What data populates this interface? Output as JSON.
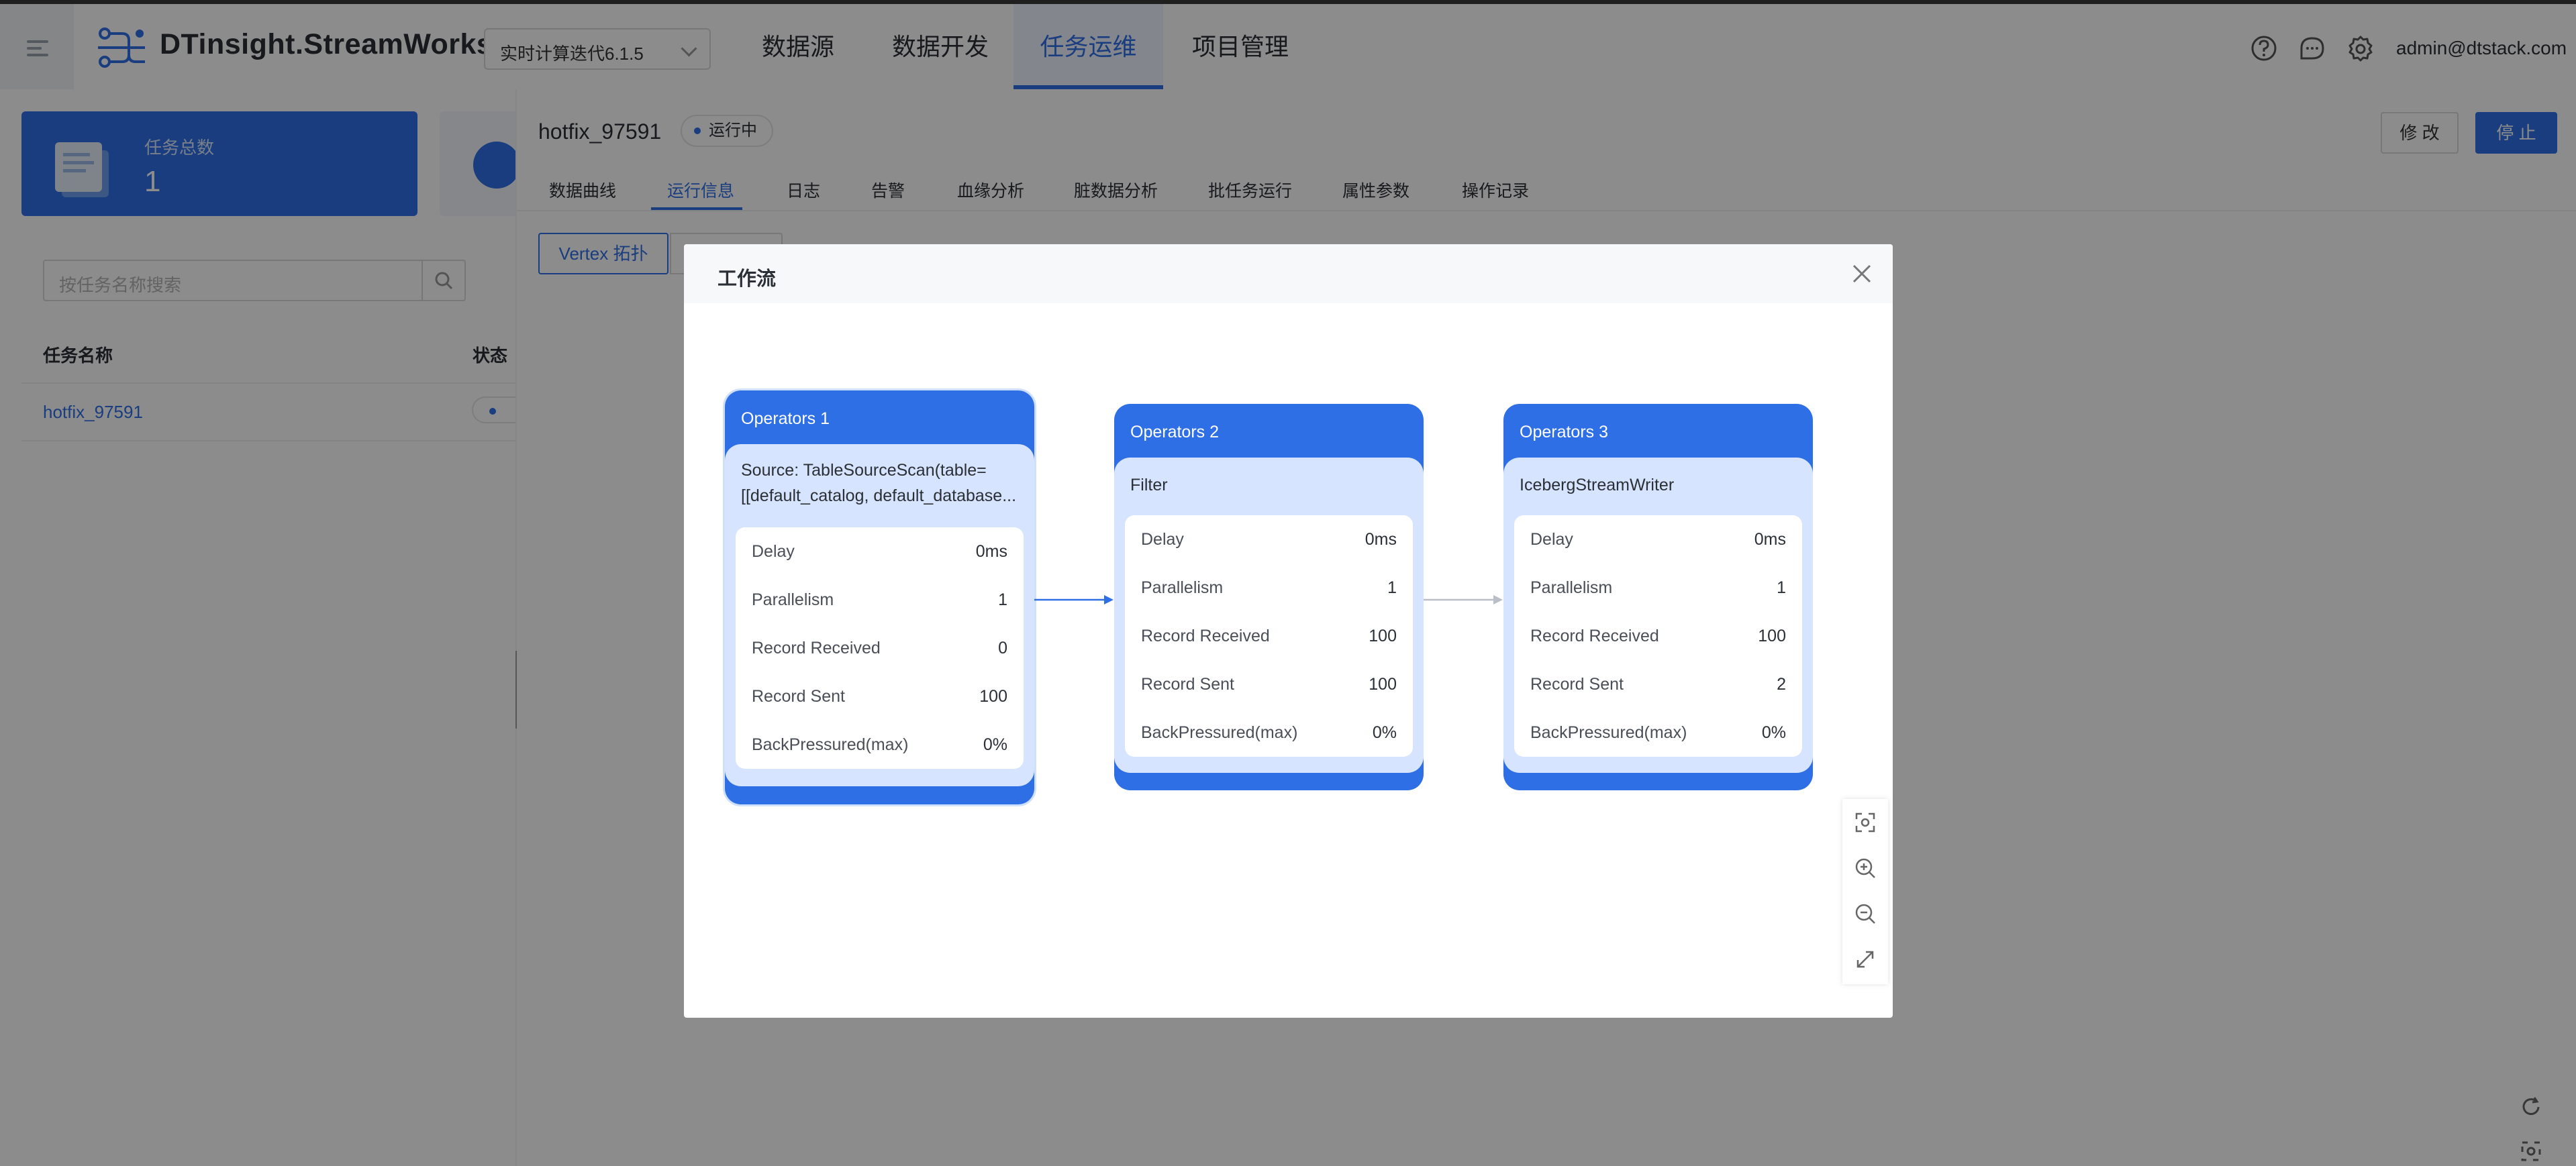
{
  "header": {
    "brand": "DTinsight.StreamWorks",
    "version_select": "实时计算迭代6.1.5",
    "nav": [
      "数据源",
      "数据开发",
      "任务运维",
      "项目管理"
    ],
    "nav_active": "任务运维",
    "user": "admin@dtstack.com",
    "icons": [
      "help-icon",
      "message-icon",
      "settings-icon"
    ]
  },
  "sidebar": {
    "stat_title": "任务总数",
    "stat_value": "1",
    "search_placeholder": "按任务名称搜索",
    "columns": [
      "任务名称",
      "状态"
    ],
    "rows": [
      {
        "name": "hotfix_97591"
      }
    ]
  },
  "task": {
    "name": "hotfix_97591",
    "status": "运行中",
    "edit_label": "修 改",
    "stop_label": "停 止",
    "tabs": [
      "数据曲线",
      "运行信息",
      "日志",
      "告警",
      "血缘分析",
      "脏数据分析",
      "批任务运行",
      "属性参数",
      "操作记录"
    ],
    "tab_active": "运行信息",
    "vertex_button": "Vertex 拓扑"
  },
  "modal": {
    "title": "工作流",
    "operators": [
      {
        "title": "Operators 1",
        "name_lines": [
          "Source: TableSourceScan(table=",
          "[[default_catalog, default_database..."
        ],
        "metrics": [
          {
            "label": "Delay",
            "value": "0ms"
          },
          {
            "label": "Parallelism",
            "value": "1"
          },
          {
            "label": "Record Received",
            "value": "0"
          },
          {
            "label": "Record Sent",
            "value": "100"
          },
          {
            "label": "BackPressured(max)",
            "value": "0%"
          }
        ]
      },
      {
        "title": "Operators 2",
        "name_lines": [
          "Filter"
        ],
        "metrics": [
          {
            "label": "Delay",
            "value": "0ms"
          },
          {
            "label": "Parallelism",
            "value": "1"
          },
          {
            "label": "Record Received",
            "value": "100"
          },
          {
            "label": "Record Sent",
            "value": "100"
          },
          {
            "label": "BackPressured(max)",
            "value": "0%"
          }
        ]
      },
      {
        "title": "Operators 3",
        "name_lines": [
          "IcebergStreamWriter"
        ],
        "metrics": [
          {
            "label": "Delay",
            "value": "0ms"
          },
          {
            "label": "Parallelism",
            "value": "1"
          },
          {
            "label": "Record Received",
            "value": "100"
          },
          {
            "label": "Record Sent",
            "value": "2"
          },
          {
            "label": "BackPressured(max)",
            "value": "0%"
          }
        ]
      }
    ],
    "tools": [
      "fit-view-icon",
      "zoom-in-icon",
      "zoom-out-icon",
      "fullscreen-icon"
    ]
  },
  "colors": {
    "accent": "#2f6fe5",
    "node_body": "#d6e4ff",
    "overlay": "rgba(0,0,0,0.45)"
  }
}
